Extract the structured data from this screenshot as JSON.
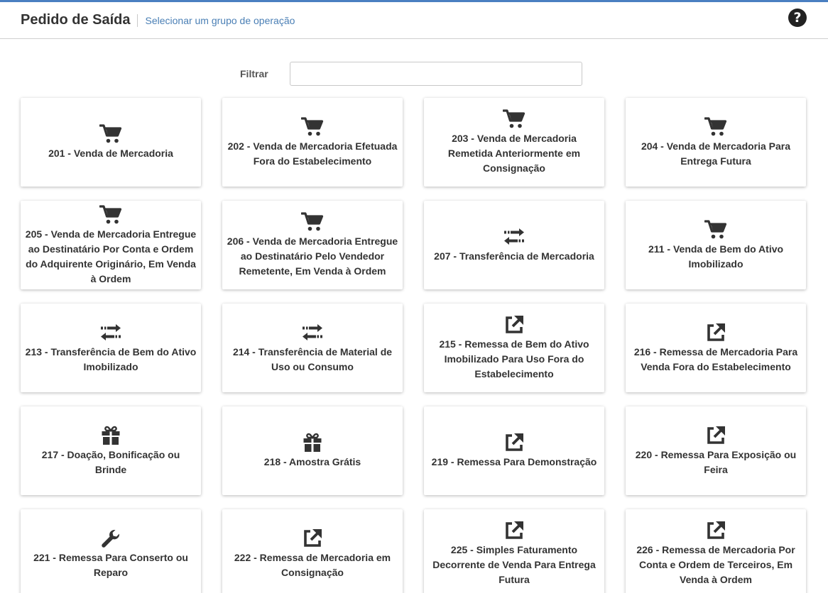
{
  "header": {
    "title": "Pedido de Saída",
    "subtitle": "Selecionar um grupo de operação",
    "help_icon": "question-circle-icon"
  },
  "filter": {
    "label": "Filtrar",
    "value": "",
    "placeholder": ""
  },
  "colors": {
    "accent": "#4a7fc1",
    "subtitle": "#4a7fb5",
    "icon": "#333333"
  },
  "operations": [
    {
      "label": "201 - Venda de Mercadoria",
      "icon": "cart"
    },
    {
      "label": "202 - Venda de Mercadoria Efetuada Fora do Estabelecimento",
      "icon": "cart"
    },
    {
      "label": "203 - Venda de Mercadoria Remetida Anteriormente em Consignação",
      "icon": "cart"
    },
    {
      "label": "204 - Venda de Mercadoria Para Entrega Futura",
      "icon": "cart"
    },
    {
      "label": "205 - Venda de Mercadoria Entregue ao Destinatário Por Conta e Ordem do Adquirente Originário, Em Venda à Ordem",
      "icon": "cart"
    },
    {
      "label": "206 - Venda de Mercadoria Entregue ao Destinatário Pelo Vendedor Remetente, Em Venda à Ordem",
      "icon": "cart"
    },
    {
      "label": "207 - Transferência de Mercadoria",
      "icon": "exchange"
    },
    {
      "label": "211 - Venda de Bem do Ativo Imobilizado",
      "icon": "cart"
    },
    {
      "label": "213 - Transferência de Bem do Ativo Imobilizado",
      "icon": "exchange"
    },
    {
      "label": "214 - Transferência de Material de Uso ou Consumo",
      "icon": "exchange"
    },
    {
      "label": "215 - Remessa de Bem do Ativo Imobilizado Para Uso Fora do Estabelecimento",
      "icon": "external-link"
    },
    {
      "label": "216 - Remessa de Mercadoria Para Venda Fora do Estabelecimento",
      "icon": "external-link"
    },
    {
      "label": "217 - Doação, Bonificação ou Brinde",
      "icon": "gift"
    },
    {
      "label": "218 - Amostra Grátis",
      "icon": "gift"
    },
    {
      "label": "219 - Remessa Para Demonstração",
      "icon": "external-link"
    },
    {
      "label": "220 - Remessa Para Exposição ou Feira",
      "icon": "external-link"
    },
    {
      "label": "221 - Remessa Para Conserto ou Reparo",
      "icon": "wrench"
    },
    {
      "label": "222 - Remessa de Mercadoria em Consignação",
      "icon": "external-link"
    },
    {
      "label": "225 - Simples Faturamento Decorrente de Venda Para Entrega Futura",
      "icon": "external-link"
    },
    {
      "label": "226 - Remessa de Mercadoria Por Conta e Ordem de Terceiros, Em Venda à Ordem",
      "icon": "external-link"
    }
  ]
}
